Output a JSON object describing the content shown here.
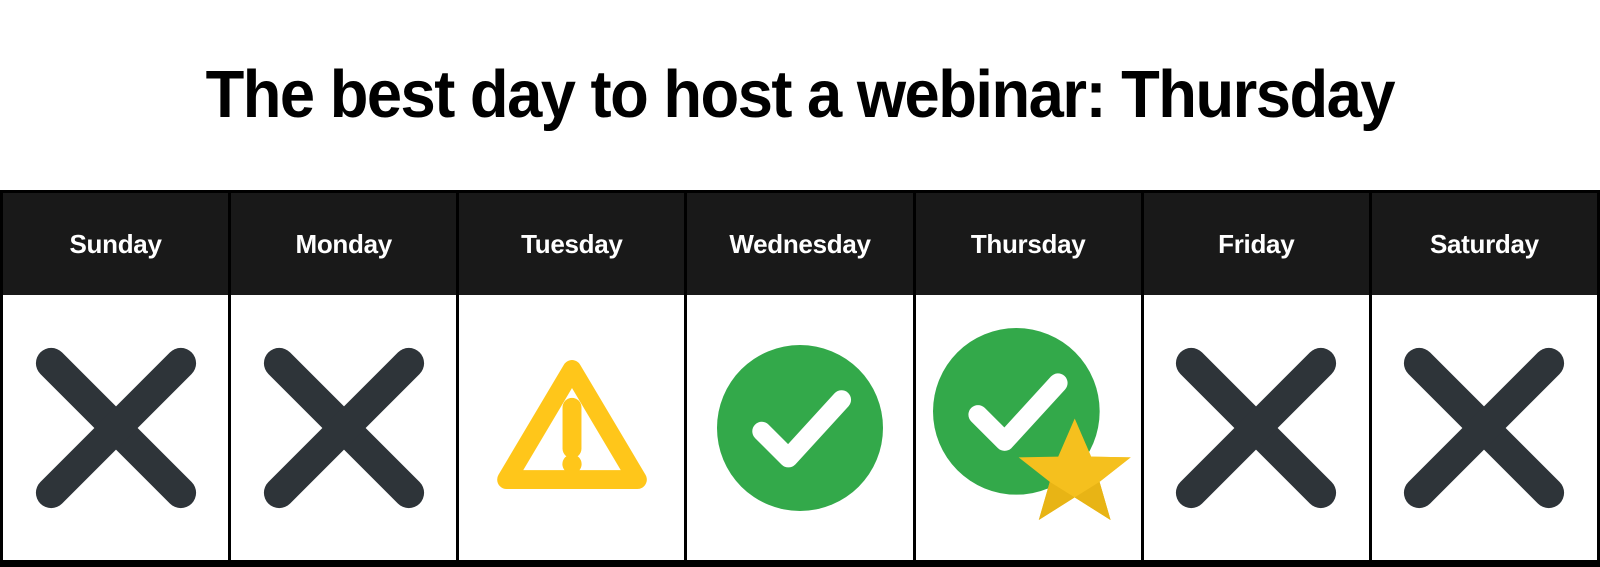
{
  "title": "The best day to host a webinar: Thursday",
  "colors": {
    "background": "#ffffff",
    "header_background": "#191919",
    "header_text": "#ffffff",
    "border": "#000000",
    "cross_dark": "#2e3439",
    "check_green": "#33a94a",
    "warning_yellow": "#ffc61a",
    "star_gold": "#f5c01e",
    "star_gold_shade": "#e0a90f",
    "title_text": "#000000"
  },
  "table": {
    "columns": [
      {
        "day": "Sunday",
        "icon": "cross-icon",
        "verdict": "not recommended"
      },
      {
        "day": "Monday",
        "icon": "cross-icon",
        "verdict": "not recommended"
      },
      {
        "day": "Tuesday",
        "icon": "warning-icon",
        "verdict": "caution"
      },
      {
        "day": "Wednesday",
        "icon": "check-icon",
        "verdict": "recommended"
      },
      {
        "day": "Thursday",
        "icon": "check-star-icon",
        "verdict": "best"
      },
      {
        "day": "Friday",
        "icon": "cross-icon",
        "verdict": "not recommended"
      },
      {
        "day": "Saturday",
        "icon": "cross-icon",
        "verdict": "not recommended"
      }
    ]
  }
}
